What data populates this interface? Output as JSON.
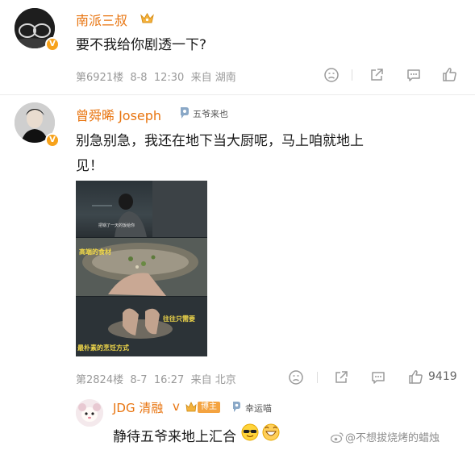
{
  "comments": [
    {
      "username": "南派三叔",
      "text": "要不我给你剧透一下?",
      "meta": "第6921楼  8-8  12:30  来自 湖南",
      "avatar": "avatar-glasses"
    },
    {
      "username": "曾舜晞 Joseph",
      "fan_badge": "五爷来也",
      "text_line1": "别急别急，我还在地下当大厨呢，马上咱就地上",
      "text_line2": "见！",
      "image_captions": [
        "高端的食材",
        "往往只需要",
        "最朴素的烹饪方式"
      ],
      "image_tiny_text": "把锅了一天的饭给你",
      "meta": "第2824楼  8-7  16:27  来自 北京",
      "like_count": "9419",
      "avatar": "avatar-man"
    }
  ],
  "reply": {
    "username": "JDG 清融",
    "v_mark": "v",
    "rank_badge": "博主",
    "fan_badge": "幸运喵",
    "text": "静待五爷来地上汇合"
  },
  "watermark": "@不想拔烧烤的蜡烛",
  "colors": {
    "username": "#e8740f",
    "meta": "#999999",
    "verified": "#f7a21b"
  }
}
